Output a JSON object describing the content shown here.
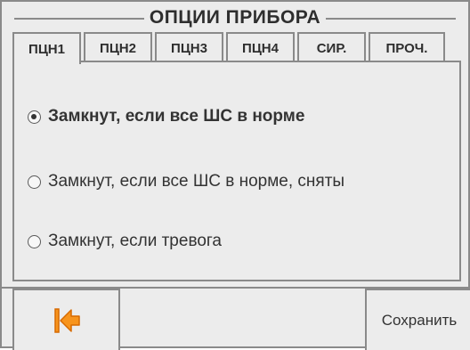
{
  "window": {
    "title": "ОПЦИИ ПРИБОРА"
  },
  "tabs": [
    {
      "label": "ПЦН1",
      "active": true
    },
    {
      "label": "ПЦН2",
      "active": false
    },
    {
      "label": "ПЦН3",
      "active": false
    },
    {
      "label": "ПЦН4",
      "active": false
    },
    {
      "label": "СИР.",
      "active": false
    },
    {
      "label": "ПРОЧ.",
      "active": false
    }
  ],
  "options": [
    {
      "label": "Замкнут, если все ШС в норме",
      "selected": true
    },
    {
      "label": "Замкнут, если все ШС в норме, сняты",
      "selected": false
    },
    {
      "label": "Замкнут, если тревога",
      "selected": false
    }
  ],
  "footer": {
    "back_icon": "arrow-left-to-bar-icon",
    "save_label": "Сохранить"
  },
  "colors": {
    "background": "#ececec",
    "border": "#8a8a8a",
    "text": "#2e2e2e",
    "icon_fill": "#f7941d",
    "icon_stroke": "#d76a00"
  }
}
